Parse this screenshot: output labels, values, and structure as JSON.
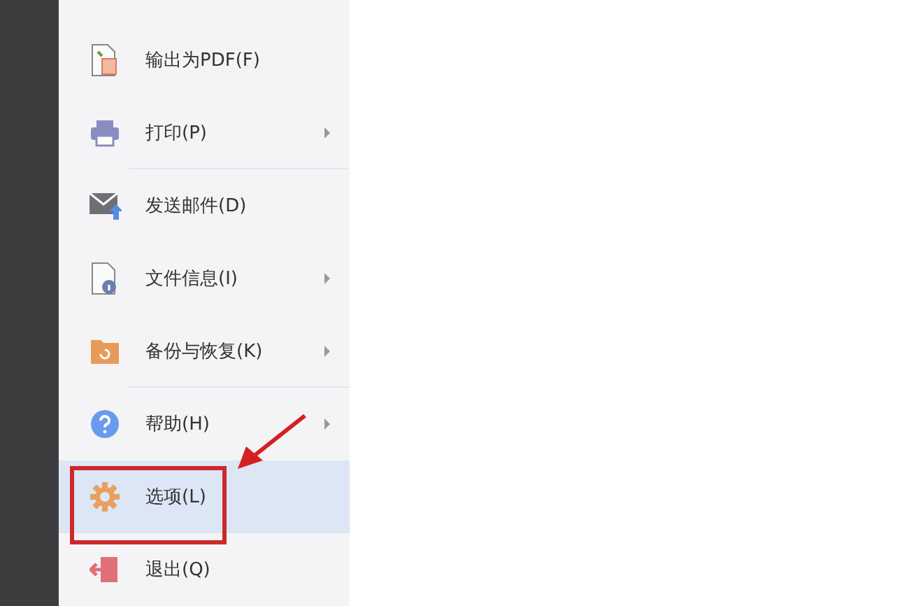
{
  "menu": {
    "items": [
      {
        "kind": "pdf",
        "label": "输出为PDF(F)",
        "submenu": false,
        "selected": false,
        "divider_after": false
      },
      {
        "kind": "print",
        "label": "打印(P)",
        "submenu": true,
        "selected": false,
        "divider_after": true
      },
      {
        "kind": "mail",
        "label": "发送邮件(D)",
        "submenu": false,
        "selected": false,
        "divider_after": false
      },
      {
        "kind": "info",
        "label": "文件信息(I)",
        "submenu": true,
        "selected": false,
        "divider_after": false
      },
      {
        "kind": "backup",
        "label": "备份与恢复(K)",
        "submenu": true,
        "selected": false,
        "divider_after": true
      },
      {
        "kind": "help",
        "label": "帮助(H)",
        "submenu": true,
        "selected": false,
        "divider_after": false
      },
      {
        "kind": "options",
        "label": "选项(L)",
        "submenu": false,
        "selected": true,
        "divider_after": false
      },
      {
        "kind": "exit",
        "label": "退出(Q)",
        "submenu": false,
        "selected": false,
        "divider_after": false
      }
    ]
  }
}
